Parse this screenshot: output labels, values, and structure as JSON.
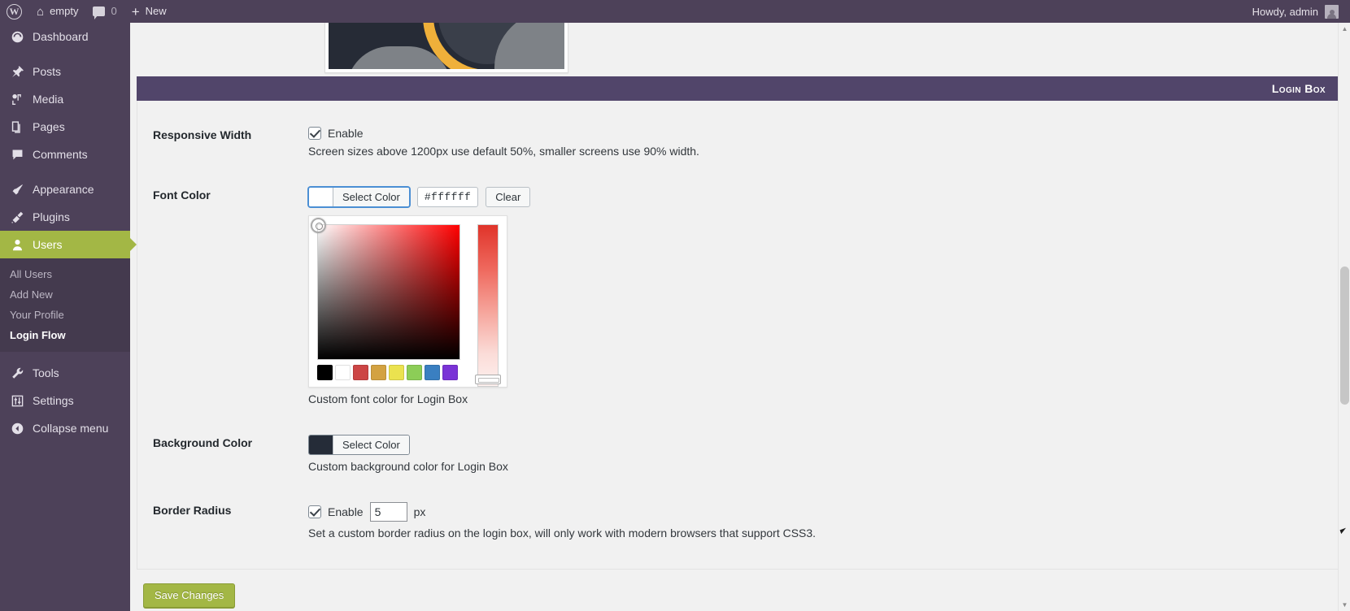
{
  "adminbar": {
    "logo_icon": "wordpress-logo-icon",
    "site_name": "empty",
    "home_icon": "home-icon",
    "comments_icon": "comment-bubble-icon",
    "comments_count": "0",
    "new_icon": "plus-icon",
    "new_label": "New",
    "howdy": "Howdy, admin",
    "avatar_icon": "avatar-icon"
  },
  "sidebar": {
    "items": [
      {
        "label": "Dashboard",
        "icon": "dashboard-icon",
        "current": false
      },
      {
        "label": "Posts",
        "icon": "pin-icon",
        "current": false
      },
      {
        "label": "Media",
        "icon": "media-icon",
        "current": false
      },
      {
        "label": "Pages",
        "icon": "pages-icon",
        "current": false
      },
      {
        "label": "Comments",
        "icon": "comment-icon",
        "current": false
      },
      {
        "label": "Appearance",
        "icon": "brush-icon",
        "current": false
      },
      {
        "label": "Plugins",
        "icon": "plug-icon",
        "current": false
      },
      {
        "label": "Users",
        "icon": "user-icon",
        "current": true
      },
      {
        "label": "Tools",
        "icon": "wrench-icon",
        "current": false
      },
      {
        "label": "Settings",
        "icon": "settings-icon",
        "current": false
      },
      {
        "label": "Collapse menu",
        "icon": "collapse-icon",
        "current": false
      }
    ],
    "submenu": [
      {
        "label": "All Users",
        "current": false
      },
      {
        "label": "Add New",
        "current": false
      },
      {
        "label": "Your Profile",
        "current": false
      },
      {
        "label": "Login Flow",
        "current": true
      }
    ]
  },
  "section": {
    "title": "Login Box"
  },
  "fields": {
    "responsive_width": {
      "label": "Responsive Width",
      "checkbox_label": "Enable",
      "checked": true,
      "description": "Screen sizes above 1200px use default 50%, smaller screens use 90% width."
    },
    "font_color": {
      "label": "Font Color",
      "select_color_label": "Select Color",
      "hex_value": "#ffffff",
      "clear_label": "Clear",
      "swatch_color": "#ffffff",
      "description": "Custom font color for Login Box",
      "picker_open": true,
      "palette": [
        "#000000",
        "#ffffff",
        "#cc4545",
        "#d3a241",
        "#ebe24f",
        "#8ccd57",
        "#3a7fc1",
        "#7a33d6"
      ]
    },
    "background_color": {
      "label": "Background Color",
      "select_color_label": "Select Color",
      "swatch_color": "#252c38",
      "description": "Custom background color for Login Box",
      "picker_open": false
    },
    "border_radius": {
      "label": "Border Radius",
      "checkbox_label": "Enable",
      "checked": true,
      "value": "5",
      "unit": "px",
      "description": "Set a custom border radius on the login box, will only work with modern browsers that support CSS3."
    }
  },
  "footer": {
    "save_label": "Save Changes"
  },
  "colors": {
    "admin_purple": "#4d4159",
    "section_header": "#51456a",
    "accent_green": "#a3b745",
    "thumb_bg": "#262b36",
    "thumb_arc": "#efb03a"
  }
}
